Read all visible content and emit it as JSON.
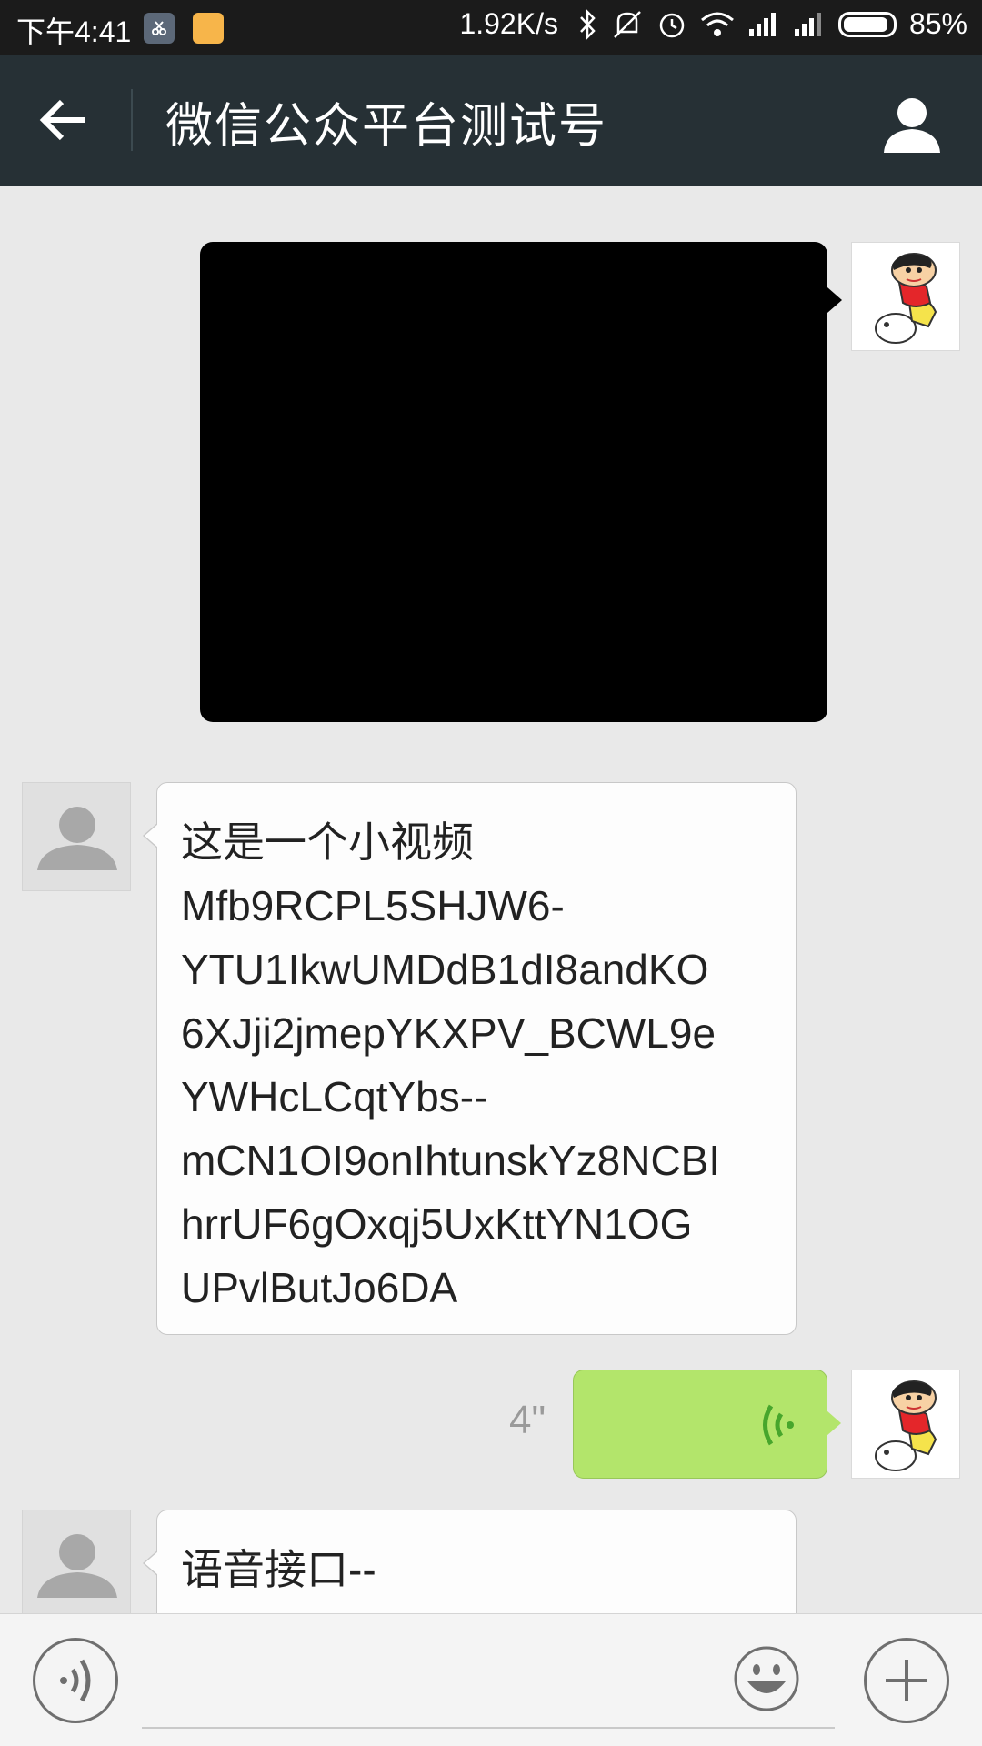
{
  "status_bar": {
    "time": "下午4:41",
    "net_speed": "1.92K/s",
    "battery_percent": "85%",
    "battery_level": 0.85
  },
  "header": {
    "title": "微信公众平台测试号"
  },
  "messages": {
    "text1_lines": [
      "这是一个小视频",
      "Mfb9RCPL5SHJW6-",
      "YTU1IkwUMDdB1dI8andKO",
      "6XJji2jmepYKXPV_BCWL9e",
      "YWHcLCqtYbs--",
      "mCN1OI9onIhtunskYz8NCBI",
      "hrrUF6gOxqj5UxKttYN1OG",
      "UPvlButJo6DA"
    ],
    "voice_duration": "4\"",
    "text2_lines": [
      "语音接口--"
    ]
  },
  "input_bar": {
    "placeholder": ""
  },
  "colors": {
    "header_bg": "#263035",
    "voice_bubble": "#b3e56b",
    "voice_icon": "#47a62c"
  },
  "icons": {
    "back": "arrow-left-icon",
    "profile": "person-icon",
    "voice": "voice-wave-icon",
    "emoji": "smile-icon",
    "plus": "plus-icon"
  }
}
